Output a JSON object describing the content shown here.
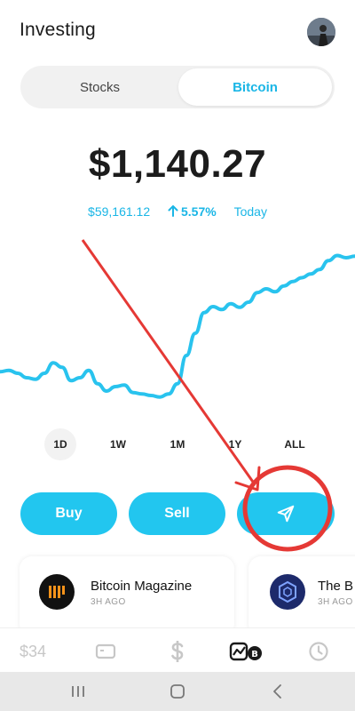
{
  "header": {
    "title": "Investing",
    "avatar": "profile-avatar"
  },
  "tabs": {
    "stocks": "Stocks",
    "bitcoin": "Bitcoin",
    "active": "Bitcoin"
  },
  "balance": {
    "amount": "$1,140.27",
    "btc_price": "$59,161.12",
    "change": "5.57%",
    "period": "Today",
    "change_icon": "arrow-up-icon"
  },
  "colors": {
    "accent": "#22c6ef",
    "accent_text": "#1ab6e6",
    "annotation": "#e53935"
  },
  "chart_data": {
    "type": "line",
    "title": "",
    "xlabel": "",
    "ylabel": "",
    "x": [
      0,
      1,
      2,
      3,
      4,
      5,
      6,
      7,
      8,
      9,
      10,
      11,
      12,
      13,
      14,
      15,
      16,
      17,
      18,
      19,
      20,
      21,
      22,
      23,
      24,
      25,
      26,
      27,
      28,
      29,
      30,
      31,
      32,
      33,
      34,
      35,
      36,
      37,
      38,
      39,
      40
    ],
    "values": [
      38,
      40,
      36,
      30,
      28,
      36,
      50,
      44,
      26,
      30,
      40,
      22,
      12,
      18,
      20,
      10,
      8,
      6,
      4,
      8,
      22,
      60,
      90,
      118,
      126,
      122,
      130,
      125,
      132,
      145,
      150,
      146,
      154,
      160,
      165,
      170,
      176,
      188,
      195,
      192,
      194
    ],
    "ylim": [
      0,
      210
    ],
    "grid": false,
    "series_color": "#29c3ee"
  },
  "ranges": [
    "1D",
    "1W",
    "1M",
    "1Y",
    "ALL"
  ],
  "active_range": "1D",
  "actions": {
    "buy": "Buy",
    "sell": "Sell",
    "send_icon": "send-paper-plane-icon"
  },
  "news": [
    {
      "title": "Bitcoin Magazine",
      "time": "3H AGO",
      "logo": "bitcoin-magazine-logo"
    },
    {
      "title": "The B",
      "time": "3H AGO",
      "logo": "cube-logo"
    }
  ],
  "bottom_nav": {
    "cash": "$34",
    "items": [
      "card-icon",
      "dollar-icon",
      "investing-icon",
      "activity-clock-icon"
    ]
  },
  "system_nav": [
    "recents-icon",
    "home-icon",
    "back-icon"
  ]
}
